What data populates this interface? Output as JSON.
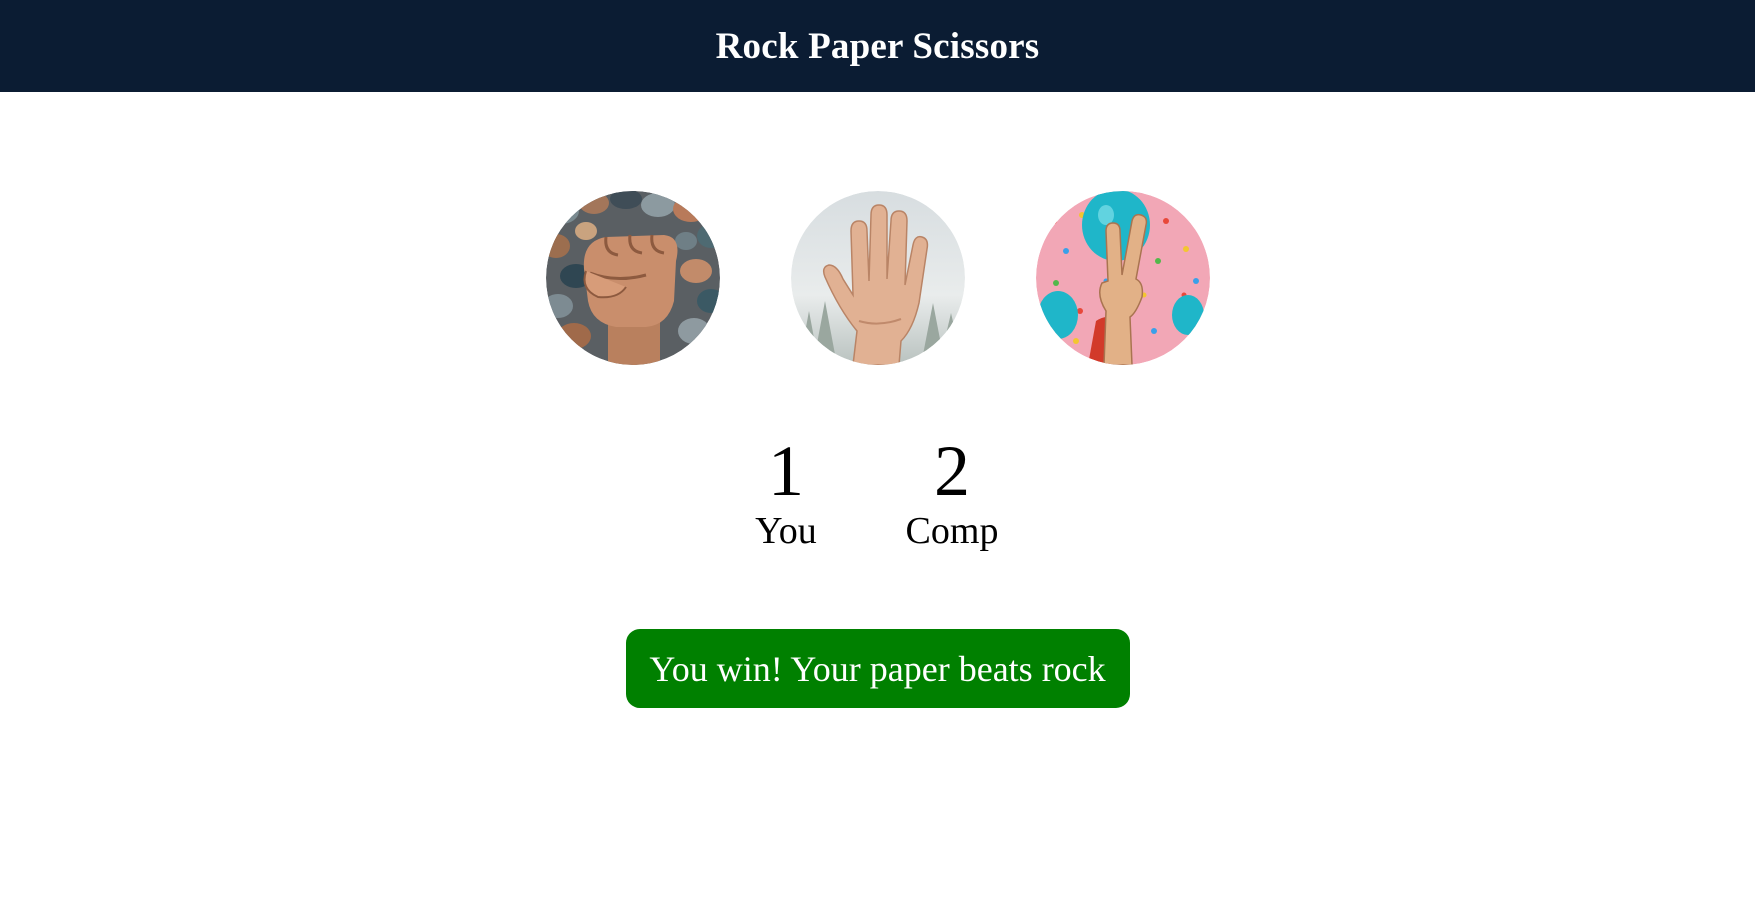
{
  "header": {
    "title": "Rock Paper Scissors"
  },
  "choices": [
    {
      "id": "rock",
      "icon": "rock-fist-icon"
    },
    {
      "id": "paper",
      "icon": "open-hand-icon"
    },
    {
      "id": "scissors",
      "icon": "peace-sign-icon"
    }
  ],
  "score": {
    "user": {
      "value": "1",
      "label": "You"
    },
    "comp": {
      "value": "2",
      "label": "Comp"
    }
  },
  "message": {
    "text": "You win! Your paper beats rock",
    "color": "#008000"
  },
  "colors": {
    "header_bg": "#0b1c33",
    "header_text": "#ffffff",
    "win": "#008000"
  }
}
